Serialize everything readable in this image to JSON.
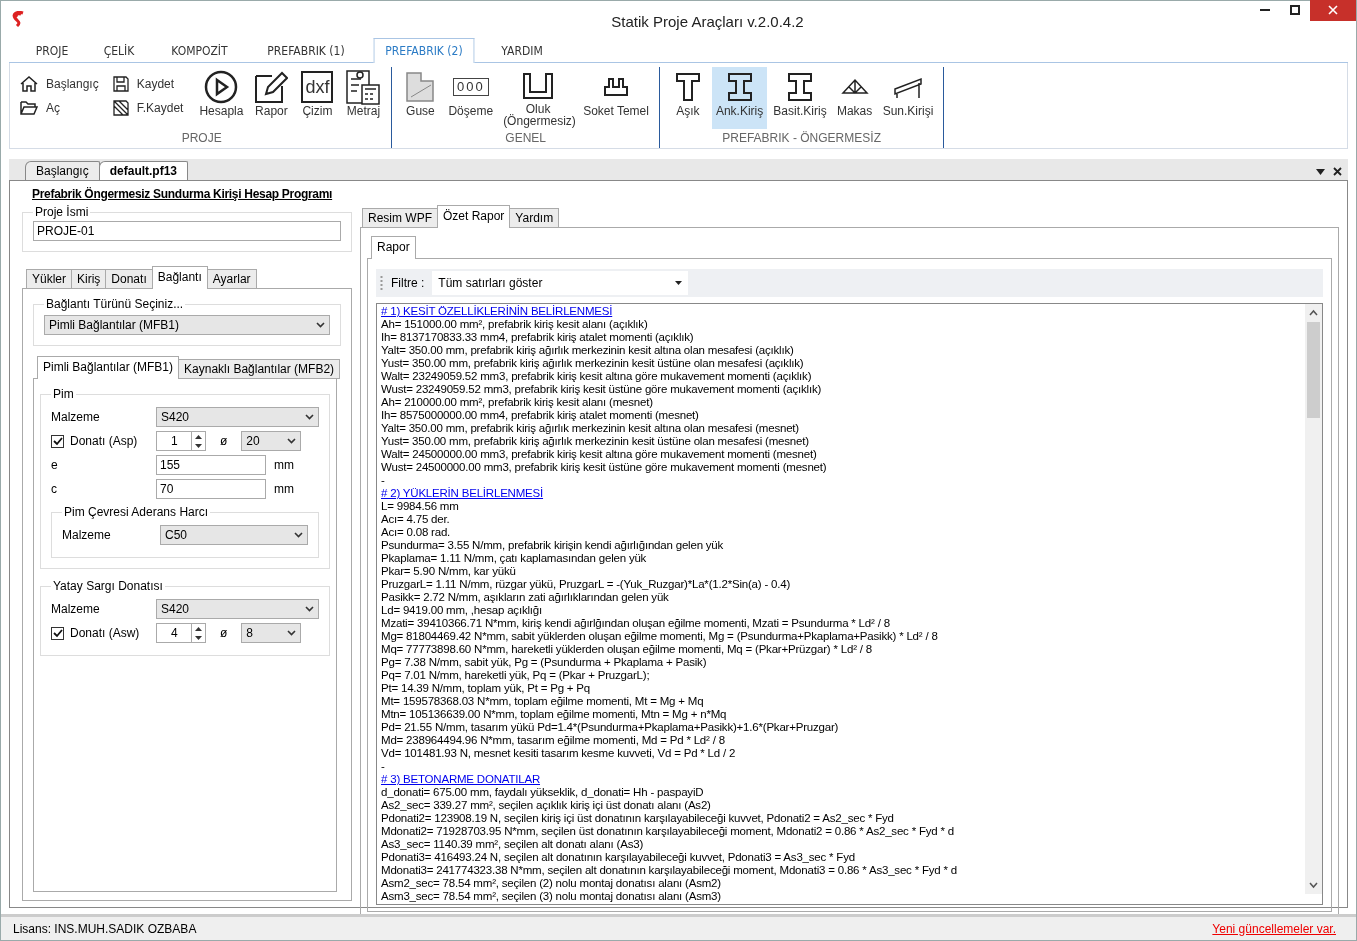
{
  "window": {
    "title": "Statik Proje Araçları v.2.0.4.2"
  },
  "menu_tabs": [
    {
      "label": "PROJE",
      "selected": false
    },
    {
      "label": "ÇELİK",
      "selected": false
    },
    {
      "label": "KOMPOZİT",
      "selected": false
    },
    {
      "label": "PREFABRIK (1)",
      "selected": false
    },
    {
      "label": "PREFABRIK (2)",
      "selected": true
    },
    {
      "label": "YARDIM",
      "selected": false
    }
  ],
  "ribbon_groups": [
    {
      "label": "PROJE",
      "buttons": [
        {
          "kind": "small",
          "label": "Başlangıç",
          "selected": false
        },
        {
          "kind": "small",
          "label": "Aç",
          "selected": false
        },
        {
          "kind": "small",
          "label": "Kaydet",
          "selected": false
        },
        {
          "kind": "small",
          "label": "F.Kaydet",
          "selected": false
        },
        {
          "kind": "large",
          "label": "Hesapla",
          "selected": false
        },
        {
          "kind": "large",
          "label": "Rapor",
          "selected": false
        },
        {
          "kind": "large",
          "label": "Çizim",
          "icon_text": "dxf",
          "selected": false
        },
        {
          "kind": "large",
          "label": "Metraj",
          "selected": false
        }
      ]
    },
    {
      "label": "GENEL",
      "buttons": [
        {
          "kind": "large",
          "label": "Guse",
          "selected": false
        },
        {
          "kind": "large",
          "label": "Döşeme",
          "icon_text": "000",
          "selected": false
        },
        {
          "kind": "large",
          "label": "Oluk (Öngermesiz)",
          "selected": false
        },
        {
          "kind": "large",
          "label": "Soket Temel",
          "selected": false
        }
      ]
    },
    {
      "label": "PREFABRIK - ÖNGERMESİZ",
      "buttons": [
        {
          "kind": "large",
          "label": "Aşık",
          "selected": false
        },
        {
          "kind": "large",
          "label": "Ank.Kiriş",
          "selected": true
        },
        {
          "kind": "large",
          "label": "Basit.Kiriş",
          "selected": false
        },
        {
          "kind": "large",
          "label": "Makas",
          "selected": false
        },
        {
          "kind": "large",
          "label": "Sun.Kirişi",
          "selected": false
        }
      ]
    }
  ],
  "doc_tabs": [
    {
      "label": "Başlangıç",
      "selected": false
    },
    {
      "label": "default.pf13",
      "selected": true
    }
  ],
  "page_title": "Prefabrik Öngermesiz Sundurma Kirişi Hesap Programı",
  "project_name": {
    "legend": "Proje İsmi",
    "value": "PROJE-01"
  },
  "left_tabs": [
    {
      "label": "Yükler",
      "selected": false
    },
    {
      "label": "Kiriş",
      "selected": false
    },
    {
      "label": "Donatı",
      "selected": false
    },
    {
      "label": "Bağlantı",
      "selected": true
    },
    {
      "label": "Ayarlar",
      "selected": false
    }
  ],
  "connection_type": {
    "legend": "Bağlantı Türünü Seçiniz...",
    "value": "Pimli Bağlantılar (MFB1)"
  },
  "sub_tabs": [
    {
      "label": "Pimli Bağlantılar (MFB1)",
      "selected": true
    },
    {
      "label": "Kaynaklı Bağlantılar (MFB2)",
      "selected": false
    }
  ],
  "pim": {
    "legend": "Pim",
    "material_label": "Malzeme",
    "material": "S420",
    "rebar": {
      "label": "Donatı (Asp)",
      "checked": true,
      "count": "1",
      "diameter_symbol": "ø",
      "diameter": "20"
    },
    "fields": [
      {
        "label": "e",
        "value": "155",
        "unit": "mm"
      },
      {
        "label": "c",
        "value": "70",
        "unit": "mm"
      }
    ],
    "mortar": {
      "legend": "Pim Çevresi Aderans Harcı",
      "material_label": "Malzeme",
      "material": "C50"
    }
  },
  "stirrup": {
    "legend": "Yatay Sargı Donatısı",
    "material_label": "Malzeme",
    "material": "S420",
    "rebar": {
      "label": "Donatı (Asw)",
      "checked": true,
      "count": "4",
      "diameter_symbol": "ø",
      "diameter": "8"
    }
  },
  "right_tabs": [
    {
      "label": "Resim WPF",
      "selected": false
    },
    {
      "label": "Özet Rapor",
      "selected": true
    },
    {
      "label": "Yardım",
      "selected": false
    }
  ],
  "report_tab": {
    "label": "Rapor",
    "selected": true
  },
  "filter": {
    "label": "Filtre :",
    "value": "Tüm satırları göster"
  },
  "report_lines": [
    {
      "kind": "heading",
      "text": "# 1) KESİT ÖZELLİKLERİNİN BELİRLENMESİ"
    },
    {
      "kind": "text",
      "text": "Ah= 151000.00 mm², prefabrik kiriş kesit alanı (açıklık)"
    },
    {
      "kind": "text",
      "text": "Ih= 8137170833.33 mm4, prefabrik kiriş atalet momenti (açıklık)"
    },
    {
      "kind": "text",
      "text": "Yalt= 350.00 mm, prefabrik kiriş ağırlık merkezinin kesit altına olan mesafesi (açıklık)"
    },
    {
      "kind": "text",
      "text": "Yust= 350.00 mm, prefabrik kiriş ağırlık merkezinin kesit üstüne olan mesafesi (açıklık)"
    },
    {
      "kind": "text",
      "text": "Walt= 23249059.52 mm3, prefabrik kiriş kesit altına göre mukavement momenti (açıklık)"
    },
    {
      "kind": "text",
      "text": "Wust= 23249059.52 mm3, prefabrik kiriş kesit üstüne göre mukavement momenti (açıklık)"
    },
    {
      "kind": "text",
      "text": "Ah= 210000.00 mm², prefabrik kiriş kesit alanı (mesnet)"
    },
    {
      "kind": "text",
      "text": "Ih= 8575000000.00 mm4, prefabrik kiriş atalet momenti (mesnet)"
    },
    {
      "kind": "text",
      "text": "Yalt= 350.00 mm, prefabrik kiriş ağırlık merkezinin kesit altına olan mesafesi (mesnet)"
    },
    {
      "kind": "text",
      "text": "Yust= 350.00 mm, prefabrik kiriş ağırlık merkezinin kesit üstüne olan mesafesi (mesnet)"
    },
    {
      "kind": "text",
      "text": "Walt= 24500000.00 mm3, prefabrik kiriş kesit altına göre mukavement momenti (mesnet)"
    },
    {
      "kind": "text",
      "text": "Wust= 24500000.00 mm3, prefabrik kiriş kesit üstüne göre mukavement momenti (mesnet)"
    },
    {
      "kind": "text",
      "text": "-"
    },
    {
      "kind": "heading",
      "text": "# 2) YÜKLERİN BELİRLENMESİ"
    },
    {
      "kind": "text",
      "text": "L= 9984.56 mm"
    },
    {
      "kind": "text",
      "text": "Acı= 4.75 der."
    },
    {
      "kind": "text",
      "text": "Acı= 0.08 rad."
    },
    {
      "kind": "text",
      "text": "Psundurma= 3.55 N/mm, prefabrik kirişin kendi ağırlığından gelen yük"
    },
    {
      "kind": "text",
      "text": "Pkaplama= 1.11 N/mm, çatı kaplamasından gelen yük"
    },
    {
      "kind": "text",
      "text": "Pkar= 5.90 N/mm, kar yükü"
    },
    {
      "kind": "text",
      "text": "PruzgarL= 1.11 N/mm, rüzgar yükü, PruzgarL = -(Yuk_Ruzgar)*La*(1.2*Sin(a) - 0.4)"
    },
    {
      "kind": "text",
      "text": "Pasikk= 2.72 N/mm, aşıkların zati ağırlıklarından gelen yük"
    },
    {
      "kind": "text",
      "text": "Ld= 9419.00 mm, ,hesap açıklığı"
    },
    {
      "kind": "text",
      "text": "Mzati= 39410366.71 N*mm, kiriş kendi ağırlğından oluşan eğilme momenti, Mzati = Psundurma * Ld² / 8"
    },
    {
      "kind": "text",
      "text": "Mg= 81804469.42 N*mm, sabit yüklerden oluşan eğilme momenti, Mg = (Psundurma+Pkaplama+Pasikk) * Ld² / 8"
    },
    {
      "kind": "text",
      "text": "Mq= 77773898.60 N*mm, hareketli yüklerden oluşan eğilme momenti, Mq = (Pkar+Prüzgar) * Ld² / 8"
    },
    {
      "kind": "text",
      "text": "Pg= 7.38 N/mm, sabit yük, Pg = (Psundurma + Pkaplama + Pasik)"
    },
    {
      "kind": "text",
      "text": "Pq= 7.01 N/mm, hareketli yük, Pq = (Pkar + PruzgarL);"
    },
    {
      "kind": "text",
      "text": "Pt= 14.39 N/mm, toplam yük, Pt = Pg + Pq"
    },
    {
      "kind": "text",
      "text": "Mt= 159578368.03 N*mm, toplam eğilme momenti, Mt = Mg + Mq"
    },
    {
      "kind": "text",
      "text": "Mtn= 105136639.00 N*mm, toplam eğilme momenti, Mtn = Mg + n*Mq"
    },
    {
      "kind": "text",
      "text": "Pd= 21.55 N/mm, tasarım yükü Pd=1.4*(Psundurma+Pkaplama+Pasikk)+1.6*(Pkar+Pruzgar)"
    },
    {
      "kind": "text",
      "text": "Md= 238964494.96 N*mm, tasarım eğilme momenti, Md = Pd * Ld² / 8"
    },
    {
      "kind": "text",
      "text": "Vd= 101481.93 N, mesnet kesiti tasarım kesme kuvveti, Vd = Pd * Ld / 2"
    },
    {
      "kind": "text",
      "text": "-"
    },
    {
      "kind": "heading",
      "text": "# 3) BETONARME DONATILAR"
    },
    {
      "kind": "text",
      "text": "d_donati= 675.00 mm, faydalı yükseklik, d_donati= Hh - paspayiD"
    },
    {
      "kind": "text",
      "text": "As2_sec= 339.27 mm², seçilen açıklık kiriş içi üst donatı alanı (As2)"
    },
    {
      "kind": "text",
      "text": "Pdonati2= 123908.19 N, seçilen kiriş içi üst donatının karşılayabileceği kuvvet, Pdonati2 = As2_sec * Fyd"
    },
    {
      "kind": "text",
      "text": "Mdonati2= 71928703.95 N*mm, seçilen üst donatının karşılayabileceği moment, Mdonati2 = 0.86 * As2_sec * Fyd * d"
    },
    {
      "kind": "text",
      "text": "As3_sec= 1140.39 mm², seçilen alt donatı alanı (As3)"
    },
    {
      "kind": "text",
      "text": "Pdonati3= 416493.24 N, seçilen alt donatının karşılayabileceği kuvvet, Pdonati3 = As3_sec * Fyd"
    },
    {
      "kind": "text",
      "text": "Mdonati3= 241774323.38 N*mm, seçilen alt donatının karşılayabileceği moment, Mdonati3 = 0.86 * As3_sec * Fyd * d"
    },
    {
      "kind": "text",
      "text": "Asm2_sec= 78.54 mm², seçilen (2) nolu montaj donatısı alanı (Asm2)"
    },
    {
      "kind": "text",
      "text": "Asm3_sec= 78.54 mm², seçilen (3) nolu montaj donatısı alanı (Asm3)"
    }
  ],
  "status": {
    "license": "Lisans: INS.MUH.SADIK OZBABA",
    "update_link": "Yeni güncellemeler var."
  }
}
